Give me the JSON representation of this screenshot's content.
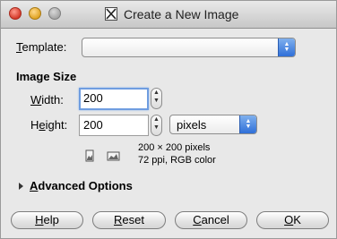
{
  "window": {
    "title": "Create a New Image",
    "app_icon": "x11-icon"
  },
  "template": {
    "label_prefix": "",
    "label_mnemonic": "T",
    "label_rest": "emplate:",
    "value": ""
  },
  "image_size": {
    "heading": "Image Size",
    "width": {
      "label_mnemonic": "W",
      "label_rest": "idth:",
      "value": "200"
    },
    "height": {
      "label_prefix": "H",
      "label_mnemonic": "e",
      "label_rest": "ight:",
      "value": "200"
    },
    "unit": "pixels",
    "info_line1": "200 × 200 pixels",
    "info_line2": "72 ppi, RGB color",
    "icons": [
      "portrait-orientation-icon",
      "landscape-orientation-icon"
    ]
  },
  "advanced": {
    "label_mnemonic": "A",
    "label_rest": "dvanced Options",
    "expanded": false
  },
  "buttons": {
    "help": {
      "mnemonic": "H",
      "rest": "elp"
    },
    "reset": {
      "mnemonic": "R",
      "rest": "eset"
    },
    "cancel": {
      "mnemonic": "C",
      "rest": "ancel"
    },
    "ok": {
      "mnemonic": "O",
      "rest": "K"
    }
  },
  "colors": {
    "accent": "#2f6fd8",
    "focus_ring": "#6f9de0",
    "window_bg": "#e8e8e8"
  }
}
